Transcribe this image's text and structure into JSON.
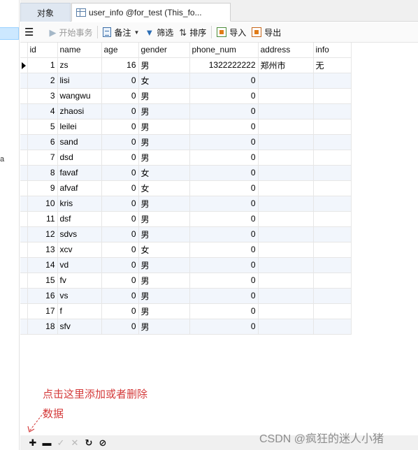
{
  "left_panel": {
    "fragment": "a"
  },
  "tabs": [
    {
      "label": "对象"
    },
    {
      "label": "user_info @for_test (This_fo..."
    }
  ],
  "toolbar": {
    "begin_transaction": "开始事务",
    "note": "备注",
    "filter": "筛选",
    "sort": "排序",
    "import": "导入",
    "export": "导出"
  },
  "grid": {
    "columns": [
      "id",
      "name",
      "age",
      "gender",
      "phone_num",
      "address",
      "info"
    ],
    "rows": [
      {
        "id": "1",
        "name": "zs",
        "age": "16",
        "gender": "男",
        "phone_num": "1322222222",
        "address": "郑州市",
        "info": "无"
      },
      {
        "id": "2",
        "name": "lisi",
        "age": "0",
        "gender": "女",
        "phone_num": "0",
        "address": "",
        "info": ""
      },
      {
        "id": "3",
        "name": "wangwu",
        "age": "0",
        "gender": "男",
        "phone_num": "0",
        "address": "",
        "info": ""
      },
      {
        "id": "4",
        "name": "zhaosi",
        "age": "0",
        "gender": "男",
        "phone_num": "0",
        "address": "",
        "info": ""
      },
      {
        "id": "5",
        "name": "leilei",
        "age": "0",
        "gender": "男",
        "phone_num": "0",
        "address": "",
        "info": ""
      },
      {
        "id": "6",
        "name": "sand",
        "age": "0",
        "gender": "男",
        "phone_num": "0",
        "address": "",
        "info": ""
      },
      {
        "id": "7",
        "name": "dsd",
        "age": "0",
        "gender": "男",
        "phone_num": "0",
        "address": "",
        "info": ""
      },
      {
        "id": "8",
        "name": "favaf",
        "age": "0",
        "gender": "女",
        "phone_num": "0",
        "address": "",
        "info": ""
      },
      {
        "id": "9",
        "name": "afvaf",
        "age": "0",
        "gender": "女",
        "phone_num": "0",
        "address": "",
        "info": ""
      },
      {
        "id": "10",
        "name": "kris",
        "age": "0",
        "gender": "男",
        "phone_num": "0",
        "address": "",
        "info": ""
      },
      {
        "id": "11",
        "name": "dsf",
        "age": "0",
        "gender": "男",
        "phone_num": "0",
        "address": "",
        "info": ""
      },
      {
        "id": "12",
        "name": "sdvs",
        "age": "0",
        "gender": "男",
        "phone_num": "0",
        "address": "",
        "info": ""
      },
      {
        "id": "13",
        "name": "xcv",
        "age": "0",
        "gender": "女",
        "phone_num": "0",
        "address": "",
        "info": ""
      },
      {
        "id": "14",
        "name": "vd",
        "age": "0",
        "gender": "男",
        "phone_num": "0",
        "address": "",
        "info": ""
      },
      {
        "id": "15",
        "name": "fv",
        "age": "0",
        "gender": "男",
        "phone_num": "0",
        "address": "",
        "info": ""
      },
      {
        "id": "16",
        "name": "vs",
        "age": "0",
        "gender": "男",
        "phone_num": "0",
        "address": "",
        "info": ""
      },
      {
        "id": "17",
        "name": "f",
        "age": "0",
        "gender": "男",
        "phone_num": "0",
        "address": "",
        "info": ""
      },
      {
        "id": "18",
        "name": "sfv",
        "age": "0",
        "gender": "男",
        "phone_num": "0",
        "address": "",
        "info": ""
      }
    ]
  },
  "annotation": {
    "line1": "点击这里添加或者删除",
    "line2": "数据",
    "color": "#d43b3b"
  },
  "bottombar": {
    "add_icon": "plus-icon",
    "delete_icon": "minus-icon",
    "apply_icon": "check-icon",
    "discard_icon": "x-icon",
    "refresh_icon": "refresh-icon",
    "stop_icon": "stop-icon"
  },
  "watermark": "CSDN @疯狂的迷人小猪"
}
